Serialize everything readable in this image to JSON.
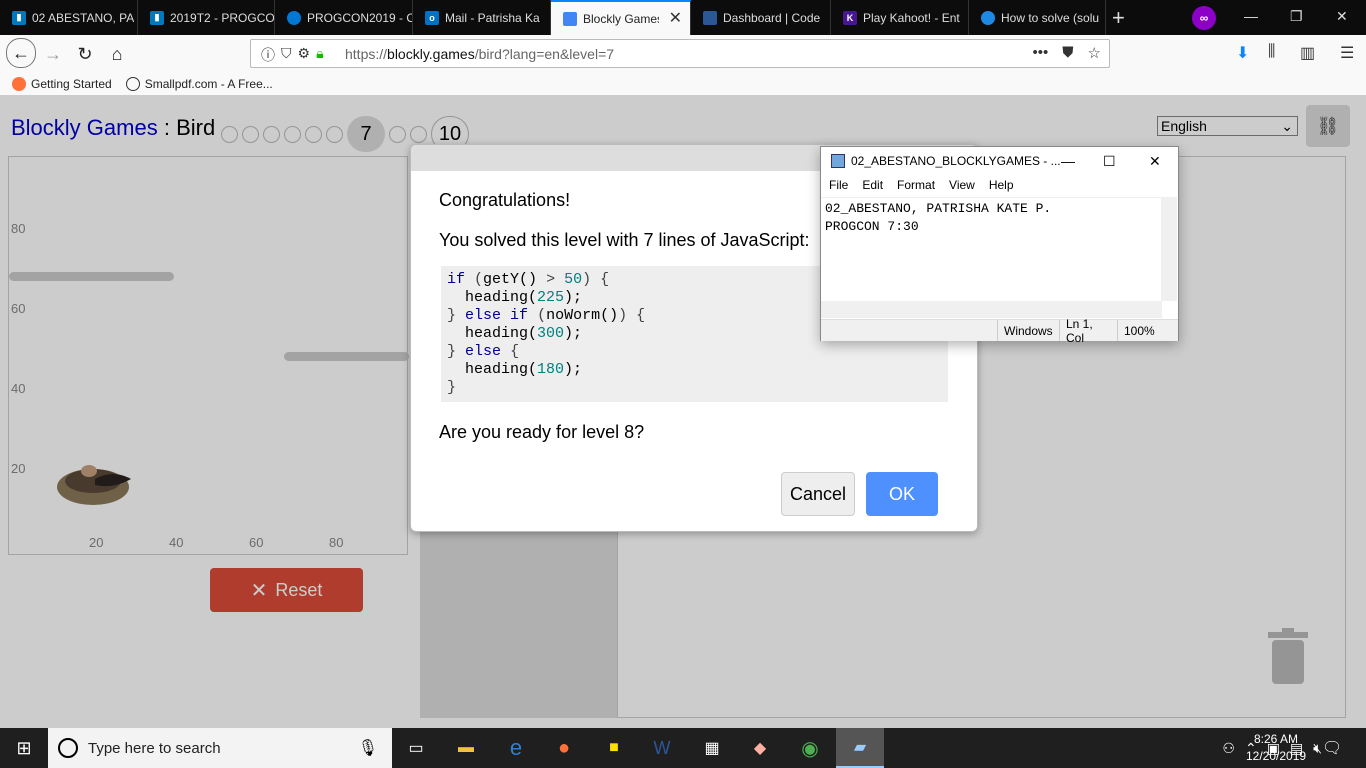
{
  "browser": {
    "tabs": [
      {
        "label": "02 ABESTANO, PA",
        "icon": "trello-icon",
        "color": "#0079bf"
      },
      {
        "label": "2019T2 - PROGCO",
        "icon": "trello-icon",
        "color": "#0079bf"
      },
      {
        "label": "PROGCON2019 - O",
        "icon": "onedrive-icon",
        "color": "#0078d4"
      },
      {
        "label": "Mail - Patrisha Ka",
        "icon": "outlook-icon",
        "color": "#0072c6"
      },
      {
        "label": "Blockly Games",
        "icon": "blockly-icon",
        "color": "#4285f4",
        "active": true
      },
      {
        "label": "Dashboard | Code",
        "icon": "code-icon",
        "color": "#2b5797"
      },
      {
        "label": "Play Kahoot! - Ent",
        "icon": "kahoot-icon",
        "color": "#46178f"
      },
      {
        "label": "How to solve (solu",
        "icon": "generic-icon",
        "color": "#1e88e5"
      }
    ],
    "url_prefix": "https://",
    "url_host": "blockly.games",
    "url_path": "/bird?lang=en&level=7",
    "bookmarks": [
      "Getting Started",
      "Smallpdf.com - A Free..."
    ]
  },
  "page": {
    "title_link": "Blockly Games",
    "title_sep": " : ",
    "title_game": "Bird",
    "current_level": "7",
    "last_level": "10",
    "language": "English",
    "y_ticks": [
      "80",
      "60",
      "40",
      "20"
    ],
    "x_ticks": [
      "20",
      "40",
      "60",
      "80"
    ],
    "reset_label": "Reset"
  },
  "dialog": {
    "heading": "Congratulations!",
    "message": "You solved this level with 7 lines of JavaScript:",
    "question": "Are you ready for level 8?",
    "cancel_label": "Cancel",
    "ok_label": "OK",
    "code_lines": [
      "if (getY() > 50) {",
      "  heading(225);",
      "} else if (noWorm()) {",
      "  heading(300);",
      "} else {",
      "  heading(180);",
      "}"
    ]
  },
  "notepad": {
    "title": "02_ABESTANO_BLOCKLYGAMES - ...",
    "menu": [
      "File",
      "Edit",
      "Format",
      "View",
      "Help"
    ],
    "line1": "02_ABESTANO, PATRISHA KATE P.",
    "line2": "PROGCON 7:30",
    "status_encoding": "Windows",
    "status_pos": "Ln 1, Col",
    "status_zoom": "100%"
  },
  "taskbar": {
    "search_placeholder": "Type here to search",
    "time": "8:26 AM",
    "date": "12/20/2019"
  },
  "colors": {
    "accent": "#0a84ff",
    "ok_button": "#4d90fe",
    "reset_button": "#dd4b39",
    "title_link": "#0000cc"
  }
}
